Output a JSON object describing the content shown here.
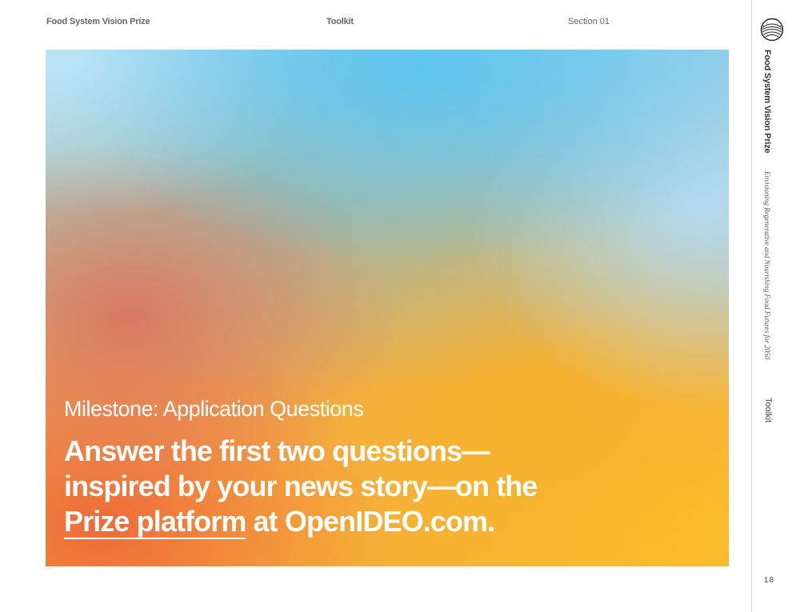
{
  "header": {
    "left_label": "Food System Vision Prize",
    "center_label": "Toolkit",
    "right_label": "Section 01"
  },
  "hero": {
    "subtitle": "Milestone: Application Questions",
    "title_line1": "Answer the first two questions—",
    "title_line2": "inspired by your news story—on the",
    "link_text": "Prize platform",
    "title_line3_rest": " at OpenIDEO.com."
  },
  "sidebar": {
    "title": "Food System Vision Prize",
    "tagline": "Envisioning Regenerative and Nourishing Food Futures for 2050",
    "section": "Toolkit",
    "page_number": "18",
    "logo_icon": "globe-stripes-icon"
  },
  "colors": {
    "text_white": "#ffffff",
    "sky_blue": "#5cc4f0",
    "orange": "#ee6a3a",
    "yellow": "#fcc428"
  }
}
